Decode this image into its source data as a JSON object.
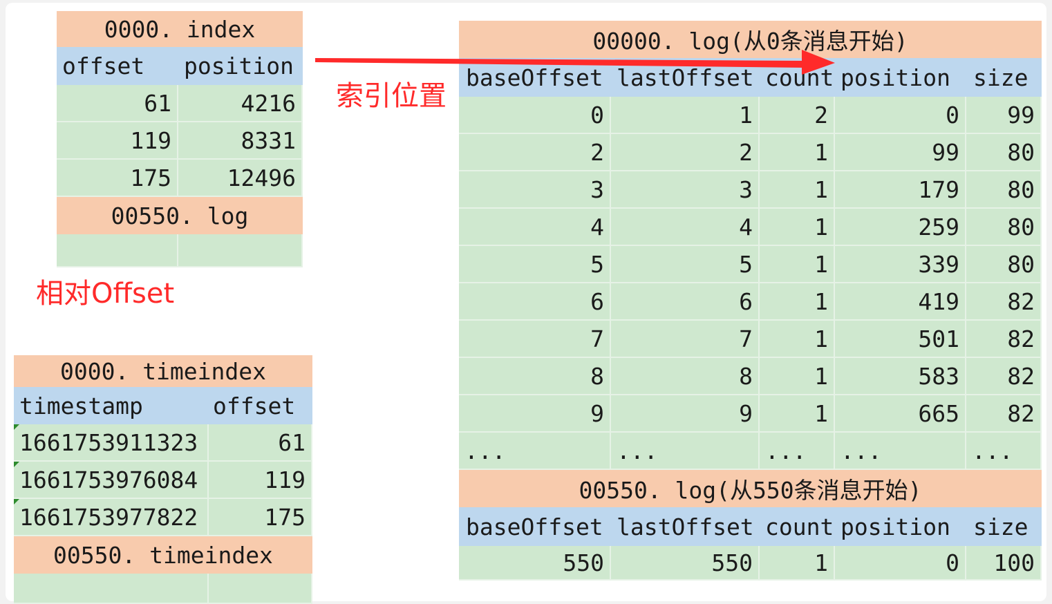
{
  "index_table": {
    "title": "0000. index",
    "columns": [
      "offset",
      "position"
    ],
    "rows": [
      [
        "61",
        "4216"
      ],
      [
        "119",
        "8331"
      ],
      [
        "175",
        "12496"
      ]
    ],
    "footer": "00550. log"
  },
  "label_relative_offset": "相对Offset",
  "label_index_position": "索引位置",
  "timeindex_table": {
    "title": "0000. timeindex",
    "columns": [
      "timestamp",
      "offset"
    ],
    "rows": [
      [
        "1661753911323",
        "61"
      ],
      [
        "1661753976084",
        "119"
      ],
      [
        "1661753977822",
        "175"
      ]
    ],
    "footer": "00550. timeindex"
  },
  "log_table": {
    "title": "00000. log(从0条消息开始)",
    "columns": [
      "baseOffset",
      "lastOffset",
      "count",
      "position",
      "size"
    ],
    "rows": [
      [
        "0",
        "1",
        "2",
        "0",
        "99"
      ],
      [
        "2",
        "2",
        "1",
        "99",
        "80"
      ],
      [
        "3",
        "3",
        "1",
        "179",
        "80"
      ],
      [
        "4",
        "4",
        "1",
        "259",
        "80"
      ],
      [
        "5",
        "5",
        "1",
        "339",
        "80"
      ],
      [
        "6",
        "6",
        "1",
        "419",
        "82"
      ],
      [
        "7",
        "7",
        "1",
        "501",
        "82"
      ],
      [
        "8",
        "8",
        "1",
        "583",
        "82"
      ],
      [
        "9",
        "9",
        "1",
        "665",
        "82"
      ]
    ],
    "ellipsis": [
      "...",
      "...",
      "...",
      "...",
      "..."
    ],
    "section2_title": "00550. log(从550条消息开始)",
    "section2_columns": [
      "baseOffset",
      "lastOffset",
      "count",
      "position",
      "size"
    ],
    "section2_rows": [
      [
        "550",
        "550",
        "1",
        "0",
        "100"
      ]
    ]
  },
  "colors": {
    "header_fill": "#f8cbad",
    "column_header_fill": "#bdd7ee",
    "data_fill": "#cfe8cf",
    "annotation_red": "#ff2a2a"
  }
}
